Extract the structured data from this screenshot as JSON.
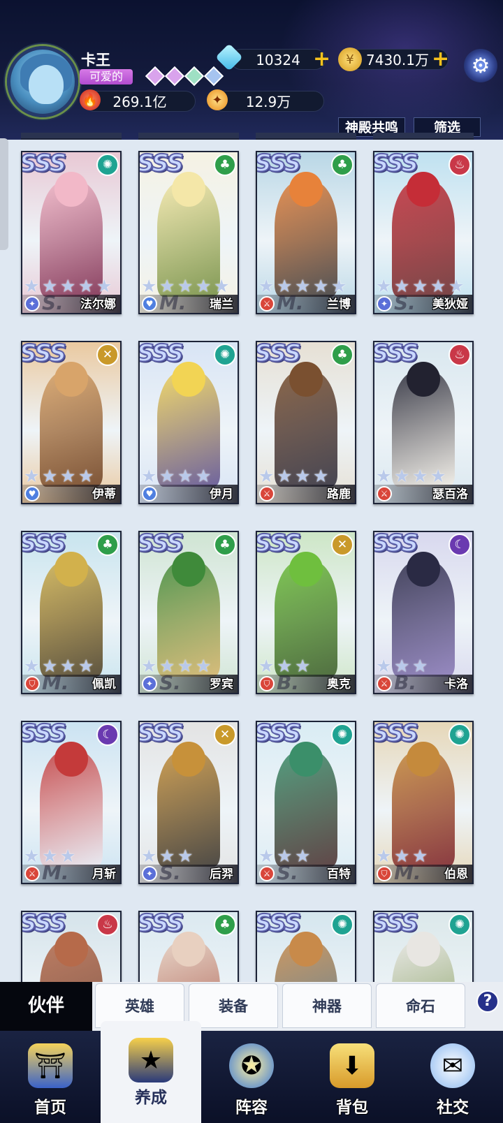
{
  "player": {
    "name": "卡王",
    "title": "可爱的",
    "power": "269.1亿",
    "honor": "12.9万"
  },
  "resources": {
    "diamonds": "10324",
    "gold": "7430.1万"
  },
  "filters": {
    "temple_resonance": "神殿共鸣",
    "filter": "筛选"
  },
  "grade_label": "SSS",
  "cards": [
    {
      "name": "法尔娜",
      "element": "wind",
      "class": "mage",
      "grade": "S.",
      "stars": 5,
      "palette": [
        "#f2b8c8",
        "#7a2a4d",
        "#e8c8d4"
      ]
    },
    {
      "name": "瑞兰",
      "element": "nature",
      "class": "heal",
      "grade": "M.",
      "stars": 5,
      "palette": [
        "#f4e7a8",
        "#6e8a3c",
        "#f5f2e3"
      ]
    },
    {
      "name": "兰博",
      "element": "nature",
      "class": "dps",
      "grade": "M.",
      "stars": 5,
      "palette": [
        "#e7823a",
        "#3e3a3a",
        "#b9d7e6"
      ]
    },
    {
      "name": "美狄娅",
      "element": "fire",
      "class": "mage",
      "grade": "S.",
      "stars": 5,
      "palette": [
        "#c52d37",
        "#6b2a2a",
        "#bfe1f0"
      ]
    },
    {
      "name": "伊蒂",
      "element": "light",
      "class": "heal",
      "grade": "",
      "stars": 4,
      "palette": [
        "#d8a46a",
        "#6b3f22",
        "#eac9a0"
      ]
    },
    {
      "name": "伊月",
      "element": "wind",
      "class": "heal",
      "grade": "",
      "stars": 4,
      "palette": [
        "#f2d454",
        "#5b4c8e",
        "#d8e4f5"
      ]
    },
    {
      "name": "路鹿",
      "element": "nature",
      "class": "dps",
      "grade": "",
      "stars": 4,
      "palette": [
        "#7a5030",
        "#2b2a3a",
        "#e6e0d4"
      ]
    },
    {
      "name": "瑟百洛",
      "element": "fire",
      "class": "dps",
      "grade": "",
      "stars": 4,
      "palette": [
        "#222230",
        "#f4efe6",
        "#d9e7ef"
      ]
    },
    {
      "name": "佩凯",
      "element": "nature",
      "class": "tank",
      "grade": "M.",
      "stars": 4,
      "palette": [
        "#d2b14c",
        "#4a3b22",
        "#c8e4ee"
      ]
    },
    {
      "name": "罗宾",
      "element": "nature",
      "class": "mage",
      "grade": "S.",
      "stars": 4,
      "palette": [
        "#3f8a3a",
        "#d7b46a",
        "#cfe4d2"
      ]
    },
    {
      "name": "奥克",
      "element": "light",
      "class": "tank",
      "grade": "B.",
      "stars": 3,
      "palette": [
        "#6fbf3e",
        "#3a5a28",
        "#cde6c6"
      ]
    },
    {
      "name": "卡洛",
      "element": "dark",
      "class": "dps",
      "grade": "B.",
      "stars": 3,
      "palette": [
        "#2a2a44",
        "#8a7ab8",
        "#d8d8ee"
      ]
    },
    {
      "name": "月斩",
      "element": "dark",
      "class": "dps",
      "grade": "M.",
      "stars": 3,
      "palette": [
        "#c43a3a",
        "#ecebf2",
        "#cbe3f2"
      ]
    },
    {
      "name": "后羿",
      "element": "light",
      "class": "mage",
      "grade": "S.",
      "stars": 3,
      "palette": [
        "#c7913a",
        "#34302a",
        "#e3e3e3"
      ]
    },
    {
      "name": "百特",
      "element": "wind",
      "class": "dps",
      "grade": "S.",
      "stars": 3,
      "palette": [
        "#3b8f6a",
        "#4a2a2a",
        "#d9ecf4"
      ]
    },
    {
      "name": "伯恩",
      "element": "wind",
      "class": "tank",
      "grade": "M.",
      "stars": 3,
      "palette": [
        "#c58a3c",
        "#7a1f2a",
        "#e6d7b8"
      ]
    },
    {
      "name": "",
      "element": "fire",
      "class": "",
      "grade": "",
      "stars": 0,
      "palette": [
        "#b66a4a",
        "#6a3a2a",
        "#d5e3ea"
      ]
    },
    {
      "name": "",
      "element": "nature",
      "class": "",
      "grade": "",
      "stars": 0,
      "palette": [
        "#e8d0c0",
        "#9a3a2a",
        "#dbe9f0"
      ]
    },
    {
      "name": "",
      "element": "wind",
      "class": "",
      "grade": "",
      "stars": 0,
      "palette": [
        "#c88a4a",
        "#3a6a8a",
        "#d5e6ee"
      ]
    },
    {
      "name": "",
      "element": "wind",
      "class": "",
      "grade": "",
      "stars": 0,
      "palette": [
        "#e8e6e2",
        "#6a8a3a",
        "#dbe8ea"
      ]
    }
  ],
  "element_colors": {
    "wind": "#1fa392",
    "nature": "#2f9e4a",
    "fire": "#c93848",
    "light": "#c9992a",
    "dark": "#6a3ab0"
  },
  "element_glyphs": {
    "wind": "✺",
    "nature": "♣",
    "fire": "♨",
    "light": "✕",
    "dark": "☾"
  },
  "class_colors": {
    "mage": "#5b6fd8",
    "heal": "#4f7fe0",
    "dps": "#d9463a",
    "tank": "#d9463a"
  },
  "class_glyphs": {
    "mage": "✦",
    "heal": "♥",
    "dps": "⚔",
    "tank": "⛉"
  },
  "tabs": {
    "active": "伙伴",
    "items": [
      "英雄",
      "装备",
      "神器",
      "命石"
    ],
    "help": "?"
  },
  "nav": [
    {
      "label": "首页",
      "icon": "home-gate-icon",
      "active": false
    },
    {
      "label": "养成",
      "icon": "star-triangle-icon",
      "active": true
    },
    {
      "label": "阵容",
      "icon": "shield-star-icon",
      "active": false
    },
    {
      "label": "背包",
      "icon": "backpack-icon",
      "active": false
    },
    {
      "label": "社交",
      "icon": "ghost-chat-icon",
      "active": false
    }
  ]
}
